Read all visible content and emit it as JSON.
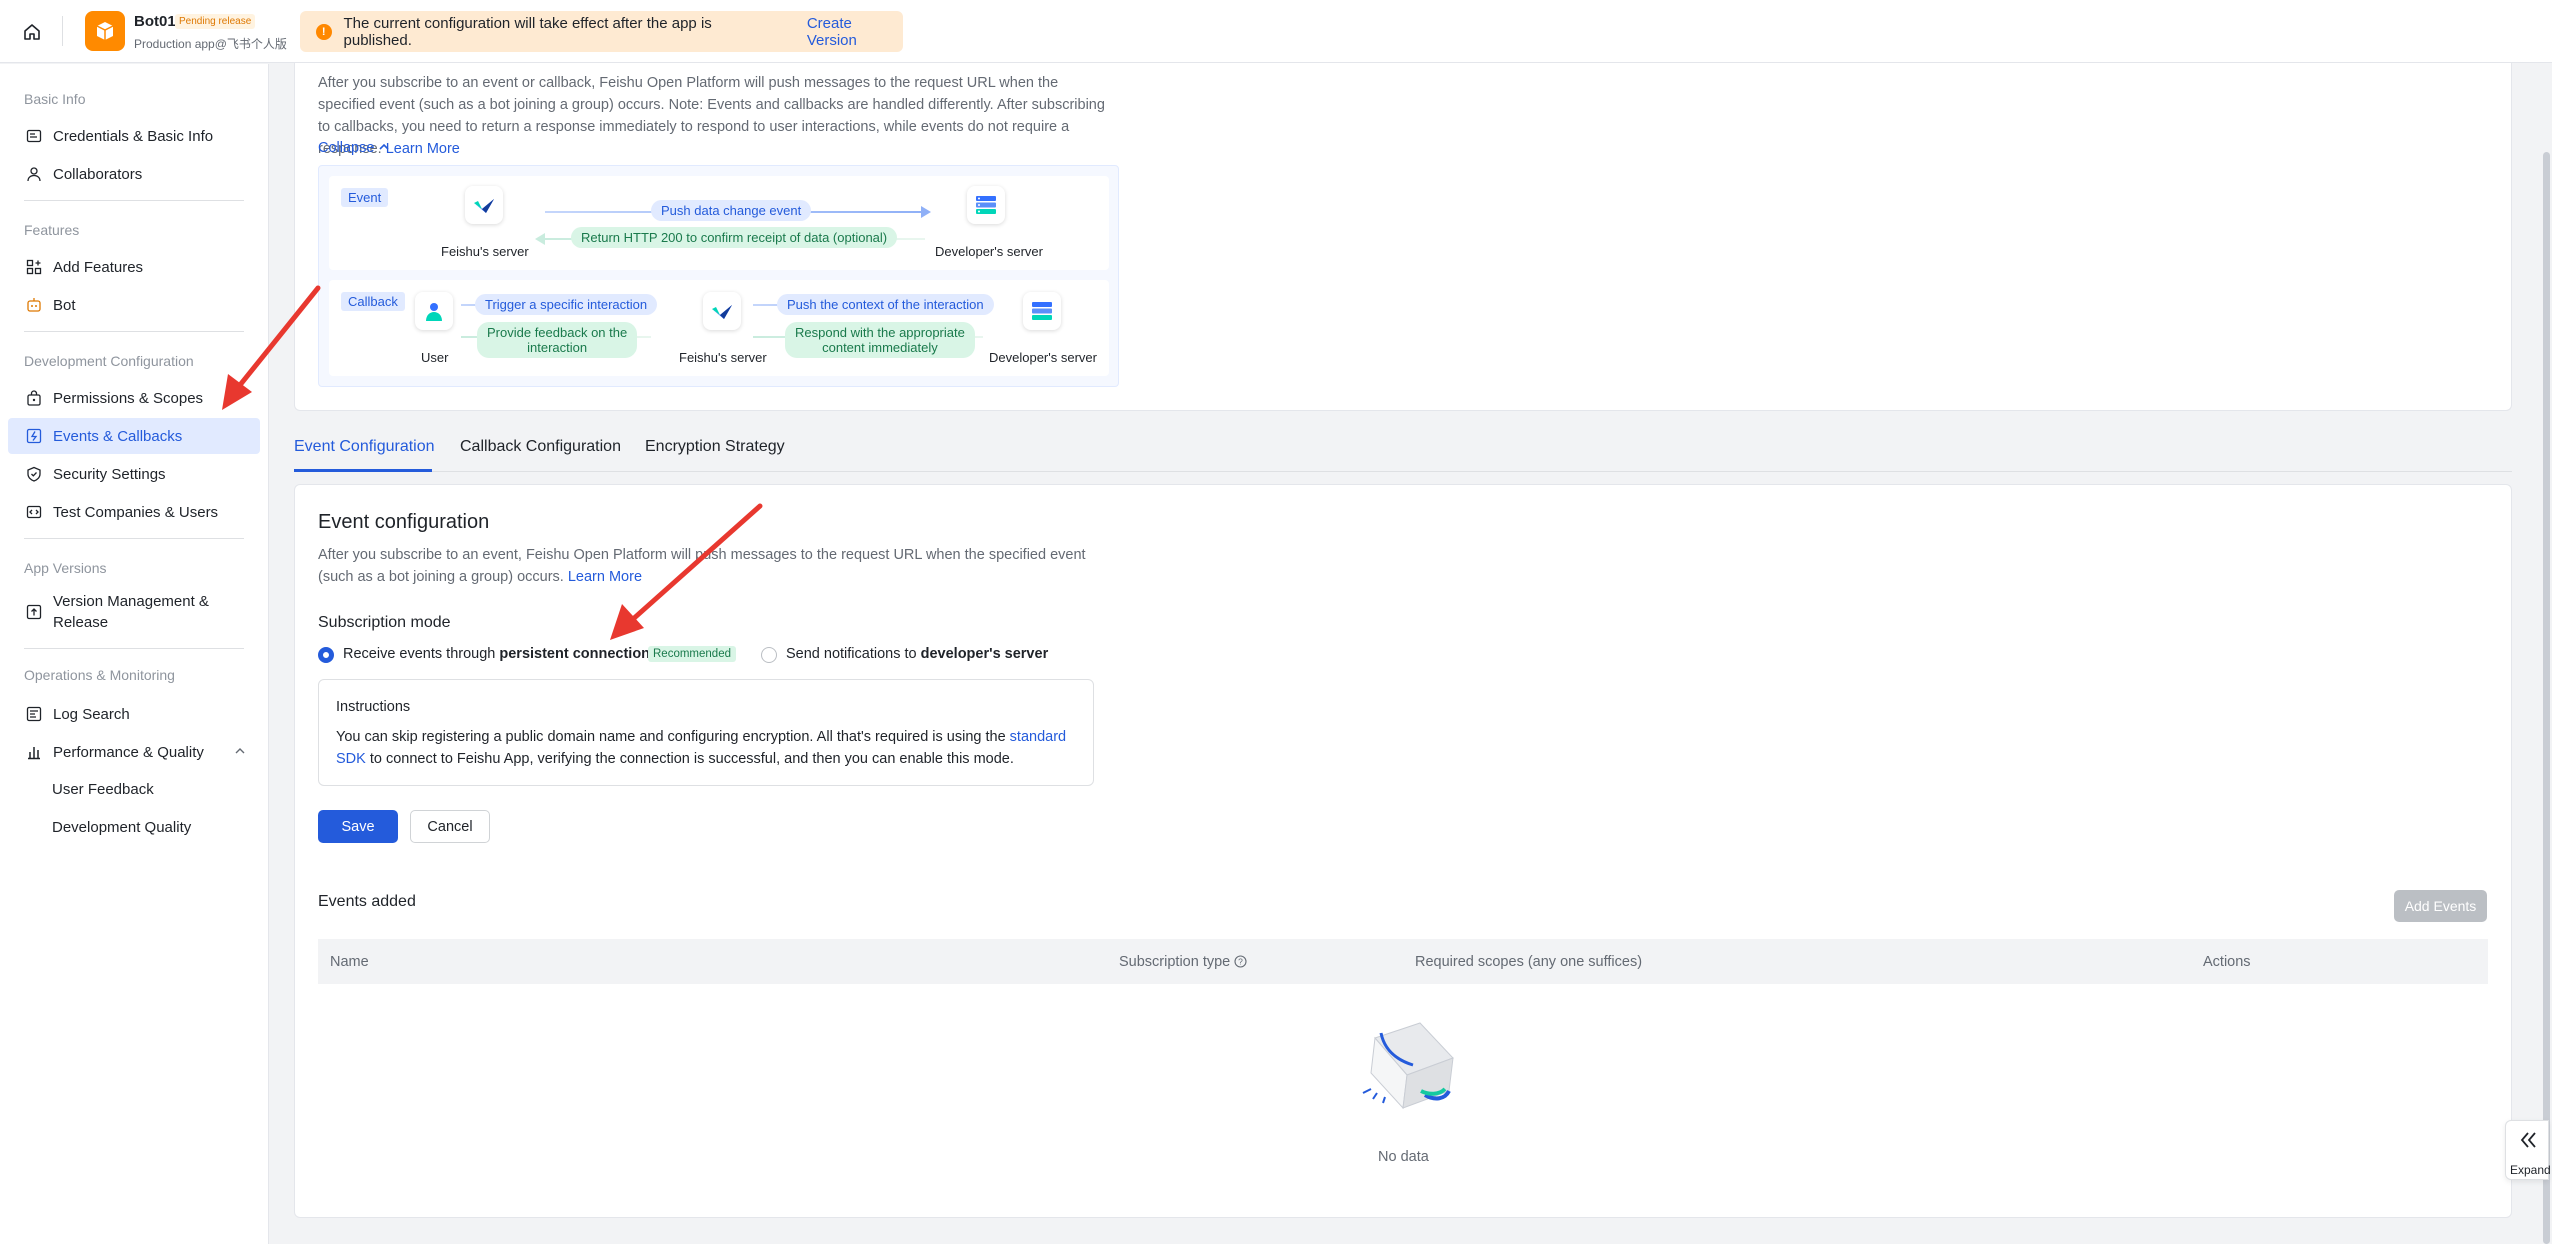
{
  "topbar": {
    "app_name": "Bot01",
    "badge": "Pending release",
    "app_sub": "Production app@飞书个人版",
    "notice_text": "The current configuration will take effect after the app is published.",
    "notice_link": "Create Version"
  },
  "sidebar": {
    "groups": {
      "basic": "Basic Info",
      "features": "Features",
      "dev": "Development Configuration",
      "versions": "App Versions",
      "ops": "Operations & Monitoring"
    },
    "items": {
      "credentials": "Credentials & Basic Info",
      "collaborators": "Collaborators",
      "add_features": "Add Features",
      "bot": "Bot",
      "permissions": "Permissions & Scopes",
      "events": "Events & Callbacks",
      "security": "Security Settings",
      "test": "Test Companies & Users",
      "version_line1": "Version Management &",
      "version_line2": "Release",
      "log_search": "Log Search",
      "performance": "Performance & Quality",
      "user_feedback": "User Feedback",
      "dev_quality": "Development Quality"
    }
  },
  "intro": {
    "text": "After you subscribe to an event or callback, Feishu Open Platform will push messages to the request URL when the specified event (such as a bot joining a group) occurs. Note: Events and callbacks are handled differently. After subscribing to callbacks, you need to return a response immediately to respond to user interactions, while events do not require a response.",
    "learn_more": "Learn More",
    "collapse": "Collapse"
  },
  "diagram": {
    "event_tag": "Event",
    "callback_tag": "Callback",
    "feishu_server": "Feishu's server",
    "developer_server": "Developer's server",
    "user": "User",
    "push_event": "Push data change event",
    "return_200": "Return HTTP 200 to confirm receipt of data (optional)",
    "trigger": "Trigger a specific interaction",
    "feedback_l1": "Provide feedback on the",
    "feedback_l2": "interaction",
    "push_context": "Push the context of the interaction",
    "respond_l1": "Respond with the appropriate",
    "respond_l2": "content immediately"
  },
  "tabs": [
    "Event Configuration",
    "Callback Configuration",
    "Encryption Strategy"
  ],
  "event_config": {
    "title": "Event configuration",
    "desc": "After you subscribe to an event, Feishu Open Platform will push messages to the request URL when the specified event (such as a bot joining a group) occurs.",
    "learn_more": "Learn More",
    "sub_mode": "Subscription mode",
    "opt1_pre": "Receive events through ",
    "opt1_bold": "persistent connection",
    "recommended": "Recommended",
    "opt2_pre": "Send notifications to ",
    "opt2_bold": "developer's server",
    "instructions_title": "Instructions",
    "instructions_pre": "You can skip registering a public domain name and configuring encryption. All that's required is using the ",
    "instructions_link": "standard SDK",
    "instructions_post": " to connect to Feishu App, verifying the connection is successful, and then you can enable this mode.",
    "save": "Save",
    "cancel": "Cancel"
  },
  "events_table": {
    "title": "Events added",
    "add_button": "Add Events",
    "columns": [
      "Name",
      "Subscription type",
      "Required scopes (any one suffices)",
      "Actions"
    ],
    "empty": "No data"
  },
  "expand": "Expand"
}
